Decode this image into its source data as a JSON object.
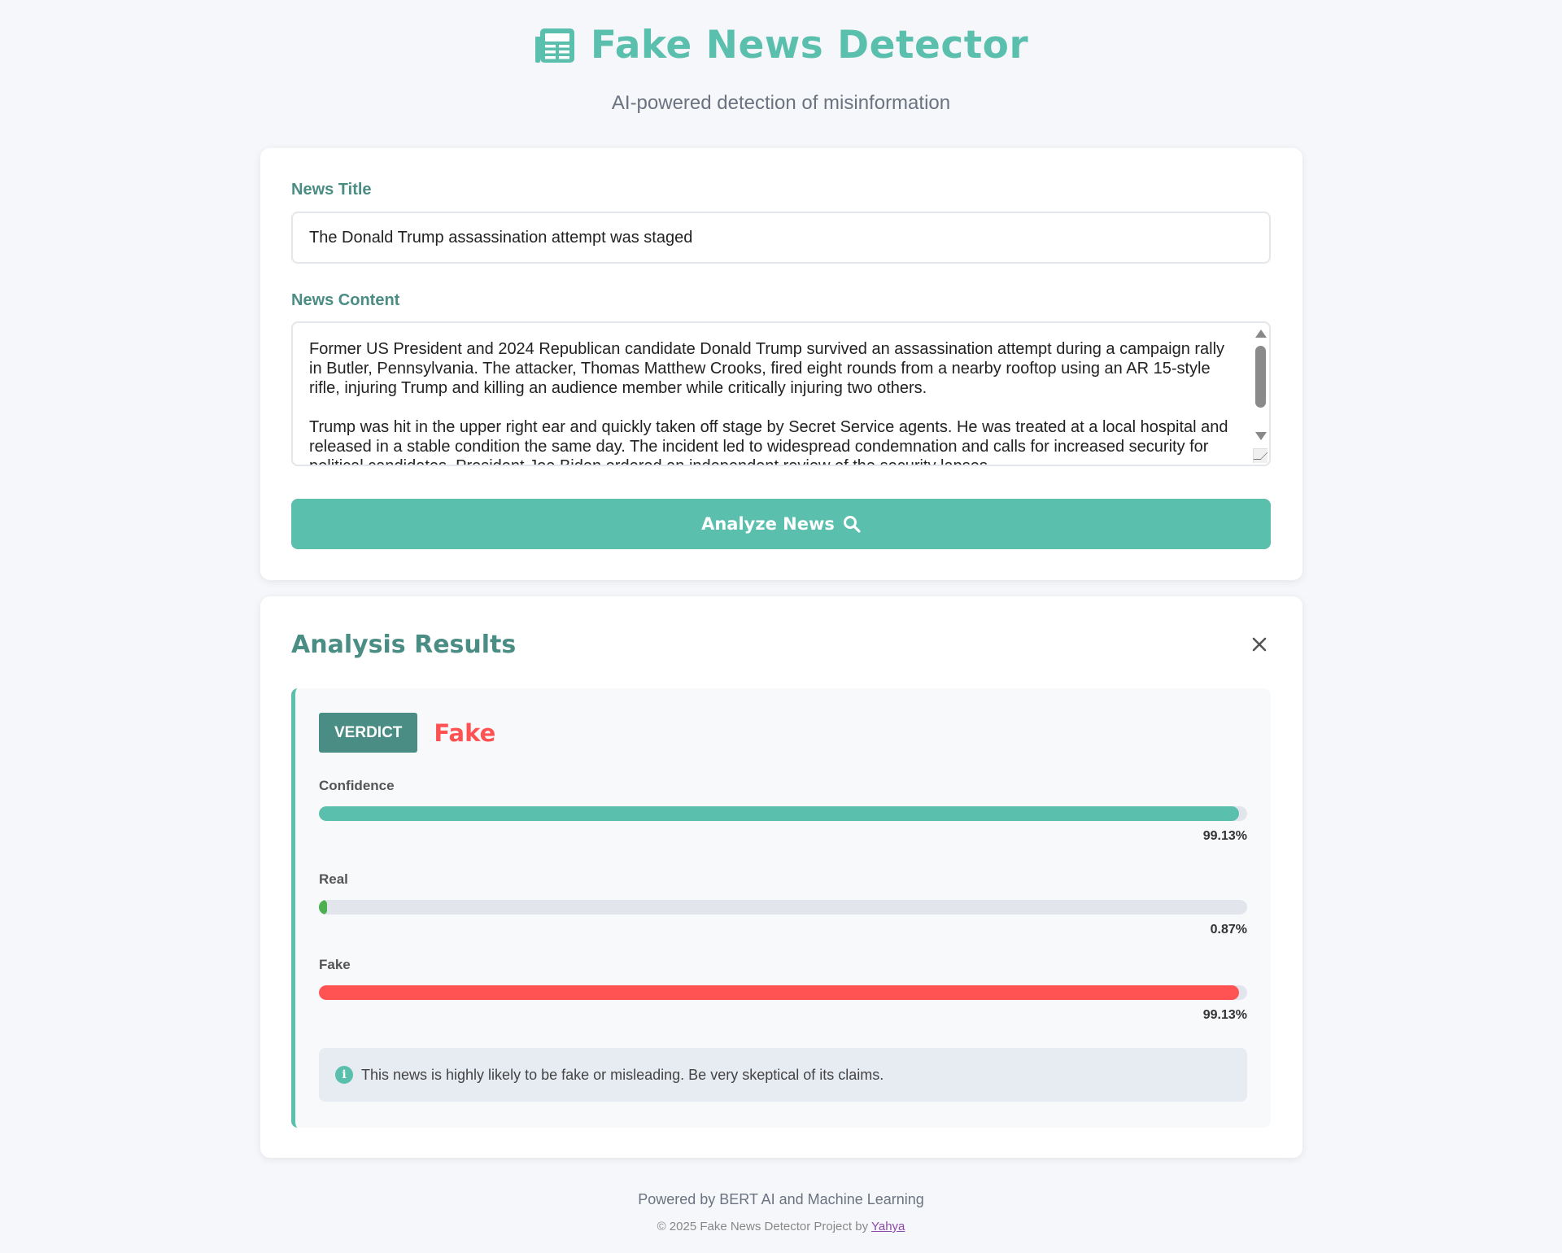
{
  "header": {
    "title": "Fake News Detector",
    "subtitle": "AI-powered detection of misinformation",
    "icon": "newspaper-icon"
  },
  "form": {
    "title_label": "News Title",
    "title_value": "The Donald Trump assassination attempt was staged",
    "content_label": "News Content",
    "content_paragraphs": [
      "Former US President and 2024 Republican candidate Donald Trump survived an assassination attempt during a campaign rally in Butler, Pennsylvania. The attacker, Thomas Matthew Crooks, fired eight rounds from a nearby rooftop using an AR 15-style rifle, injuring Trump and killing an audience member while critically injuring two others.",
      "Trump was hit in the upper right ear and quickly taken off stage by Secret Service agents. He was treated at a local hospital and released in a stable condition the same day. The incident led to widespread condemnation and calls for increased security for political candidates. President Joe Biden ordered an independent review of the security lapses"
    ],
    "analyze_label": "Analyze News",
    "analyze_icon": "search-icon"
  },
  "results": {
    "title": "Analysis Results",
    "verdict_badge": "VERDICT",
    "verdict_value": "Fake",
    "metrics": [
      {
        "label": "Confidence",
        "value_text": "99.13%",
        "fraction": 0.9913,
        "color": "#5bbfad"
      },
      {
        "label": "Real",
        "value_text": "0.87%",
        "fraction": 0.0087,
        "color": "#4caf50"
      },
      {
        "label": "Fake",
        "value_text": "99.13%",
        "fraction": 0.9913,
        "color": "#ff5252"
      }
    ],
    "info_text": "This news is highly likely to be fake or misleading. Be very skeptical of its claims."
  },
  "footer": {
    "powered": "Powered by BERT AI and Machine Learning",
    "copyright": "© 2025 Fake News Detector Project by",
    "author_link": "Yahya"
  },
  "colors": {
    "accent": "#5bbfad",
    "accent_dark": "#4a8d84",
    "fake": "#ff5252",
    "real": "#4caf50"
  }
}
